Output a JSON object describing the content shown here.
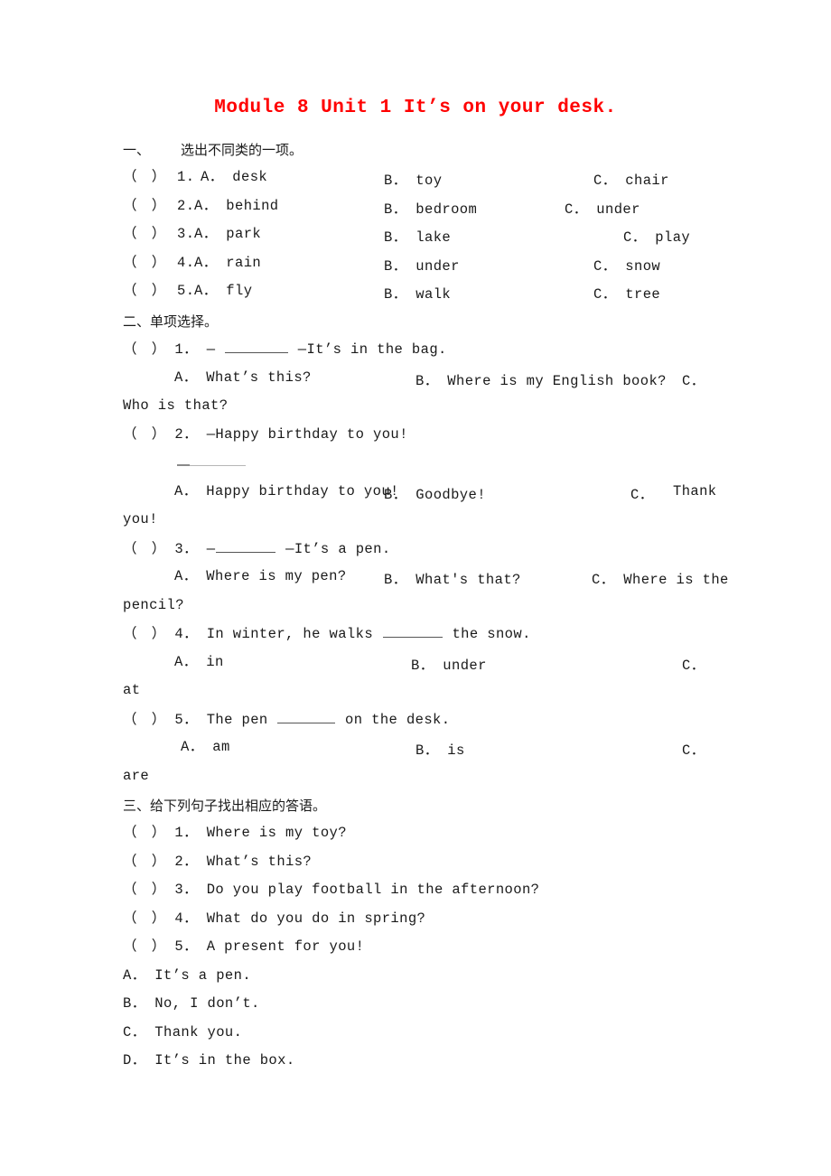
{
  "document": {
    "title": "Module 8 Unit 1 It’s on your desk.",
    "title_color": "#ff0000"
  },
  "sections": [
    {
      "index": "一、",
      "heading": "选出不同类的一项。",
      "questions": [
        {
          "marker": "（　）",
          "number": "1.",
          "a": "A． desk",
          "b": "B． toy",
          "c": "C． chair"
        },
        {
          "marker": "（　）",
          "number": "2.",
          "a": "A． behind",
          "b": "B． bedroom",
          "c": "C． under"
        },
        {
          "marker": "（　）",
          "number": "3.",
          "a": "A． park",
          "b": "B． lake",
          "c": "C． play"
        },
        {
          "marker": "（　）",
          "number": "4.",
          "a": "A． rain",
          "b": "B． under",
          "c": "C． snow"
        },
        {
          "marker": "（　）",
          "number": "5.",
          "a": "A． fly",
          "b": "B． walk",
          "c": "C． tree"
        }
      ]
    },
    {
      "index": "二、",
      "heading": "单项选择。",
      "questions": [
        {
          "stem_prefix": "（　） 1． — ",
          "stem_suffix": " —It’s in the bag.",
          "a": "A． What’s this?",
          "b": "B． Where is my English book?",
          "c_head": "C．",
          "c_tail": "Who is that?"
        },
        {
          "stem_prefix": "（　） 2． —Happy birthday to you!",
          "stem_suffix": "",
          "second_line": "—",
          "a": "A． Happy birthday to you!",
          "b": "B． Goodbye!",
          "c_head": "C．",
          "c_mid": "Thank",
          "c_tail": "you!"
        },
        {
          "stem_prefix": "（　） 3． —",
          "stem_suffix": " —It’s a pen.",
          "a": "A． Where is my pen?",
          "b": "B． What's that?",
          "c_head": "C． Where is the",
          "c_tail": "pencil?"
        },
        {
          "stem_prefix": "（　） 4． In winter, he walks ",
          "stem_suffix": " the snow.",
          "a": "A． in",
          "b": "B． under",
          "c_head": "C．",
          "c_tail": "at"
        },
        {
          "stem_prefix": "（　） 5． The pen ",
          "stem_suffix": " on the desk.",
          "a": "A． am",
          "b": "B． is",
          "c_head": "C．",
          "c_tail": "are"
        }
      ]
    },
    {
      "index": "三、",
      "heading": "给下列句子找出相应的答语。",
      "questions": [
        {
          "text": "（　） 1． Where is my toy?"
        },
        {
          "text": "（　） 2． What’s this?"
        },
        {
          "text": "（　） 3． Do you play football in the afternoon?"
        },
        {
          "text": "（　） 4． What do you do in spring?"
        },
        {
          "text": "（　） 5． A present for you!"
        }
      ],
      "answers": [
        {
          "text": "A． It’s a pen."
        },
        {
          "text": "B． No, I don’t."
        },
        {
          "text": "C． Thank you."
        },
        {
          "text": "D． It’s in the box."
        }
      ]
    }
  ]
}
